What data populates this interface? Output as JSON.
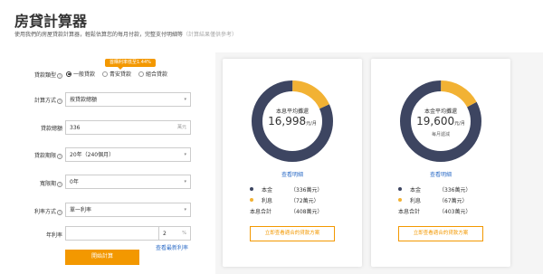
{
  "header": {
    "title": "房貸計算器",
    "subtitle": "使用我們的房屋貸款計算器，輕鬆估算您的每月付款，完整支付明細等",
    "subtitle_hint": "（計算結果僅供參考）"
  },
  "form": {
    "promo_badge": "首購利率低至1.44%",
    "loan_type": {
      "label": "貸款類型",
      "options": [
        "一般貸款",
        "青安貸款",
        "組合貸款"
      ],
      "selected": "一般貸款"
    },
    "calc_method": {
      "label": "計算方式",
      "value": "按貸款總額"
    },
    "loan_amount": {
      "label": "貸款總額",
      "value": "336",
      "unit": "萬元"
    },
    "loan_term": {
      "label": "貸款期限",
      "value": "20年（240個月）"
    },
    "grace_period": {
      "label": "寬限期",
      "value": "0年"
    },
    "rate_type": {
      "label": "利率方式",
      "value": "單一利率"
    },
    "annual_rate": {
      "label": "年利率",
      "value": "2",
      "unit": "%",
      "link": "查看最新利率"
    },
    "calc_button": "開始計算"
  },
  "results": [
    {
      "label": "本息平均攤還",
      "value": "16,998",
      "unit": "元/月",
      "sub": "",
      "detail_link": "查看明細",
      "principal_label": "本金",
      "principal_value": "（336萬元）",
      "interest_label": "利息",
      "interest_value": "（72萬元）",
      "total_label": "本息合計",
      "total_value": "（408萬元）",
      "principal_fraction": 0.82,
      "button": "立即查看適合的貸款方案"
    },
    {
      "label": "本金平均攤還",
      "value": "19,600",
      "unit": "元/月",
      "sub": "每月遞減",
      "detail_link": "查看明細",
      "principal_label": "本金",
      "principal_value": "（336萬元）",
      "interest_label": "利息",
      "interest_value": "（67萬元）",
      "total_label": "本息合計",
      "total_value": "（403萬元）",
      "principal_fraction": 0.83,
      "button": "立即查看適合的貸款方案"
    }
  ],
  "colors": {
    "accent": "#f39800",
    "principal": "#3d4561",
    "interest": "#f2b234",
    "link": "#2f6ec7"
  }
}
